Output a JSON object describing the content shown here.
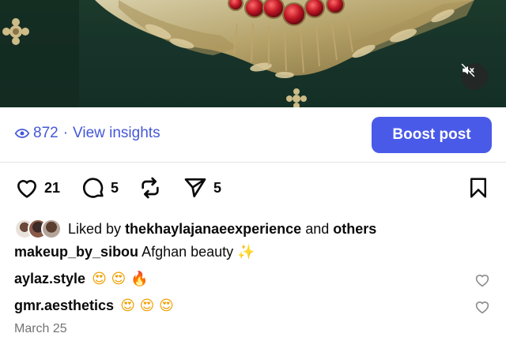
{
  "media": {
    "mute_icon": "speaker-muted-icon"
  },
  "insights": {
    "view_icon": "eye-icon",
    "count": "872",
    "separator": "·",
    "link_label": "View insights"
  },
  "boost": {
    "label": "Boost post"
  },
  "actions": {
    "like_icon": "heart-outline-icon",
    "like_count": "21",
    "comment_icon": "comment-bubble-icon",
    "comment_count": "5",
    "repost_icon": "repost-icon",
    "share_icon": "paper-plane-icon",
    "share_count": "5",
    "save_icon": "bookmark-icon"
  },
  "likes": {
    "prefix": "Liked by",
    "user": "thekhaylajanaeexperience",
    "and": "and",
    "others": "others"
  },
  "caption": {
    "user": "makeup_by_sibou",
    "text": "Afghan beauty",
    "emoji": "✨"
  },
  "comments": [
    {
      "user": "aylaz.style",
      "emojis": "😍 😍 🔥"
    },
    {
      "user": "gmr.aesthetics",
      "emojis": "😍 😍 😍"
    }
  ],
  "date": "March 25",
  "colors": {
    "accent": "#4a5ae8",
    "link": "#4458d6",
    "muted": "#737373"
  }
}
